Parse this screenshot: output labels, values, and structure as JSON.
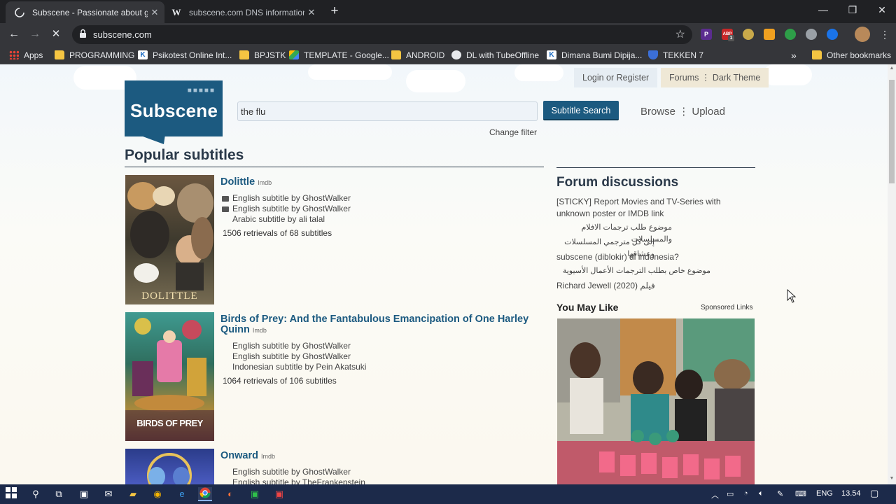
{
  "browser": {
    "tabs": [
      {
        "title": "Subscene - Passionate about goo",
        "active": true,
        "icon": "loading-spinner-icon"
      },
      {
        "title": "subscene.com DNS information -",
        "active": false,
        "icon": "w-icon"
      }
    ],
    "url": "subscene.com",
    "bookmarks": [
      "Apps",
      "PROGRAMMING",
      "Psikotest Online Int...",
      "BPJSTK",
      "TEMPLATE - Google...",
      "ANDROID",
      "DL with TubeOffline",
      "Dimana Bumi Dipija...",
      "TEKKEN 7"
    ],
    "other_bookmarks": "Other bookmarks",
    "more": "»",
    "ext_p": "P",
    "ext_abp": "ABP",
    "ext_badge": "1",
    "tab_w": "W"
  },
  "site": {
    "logo": "Subscene",
    "login": "Login or Register",
    "forums": "Forums",
    "dark_theme": "Dark Theme",
    "search_value": "the flu",
    "search_button": "Subtitle Search",
    "browse": "Browse",
    "upload": "Upload",
    "change_filter": "Change filter",
    "popular_heading": "Popular subtitles"
  },
  "movies": [
    {
      "title": "Dolittle",
      "imdb": "Imdb",
      "subs": [
        "English subtitle by GhostWalker",
        "English subtitle by GhostWalker",
        "Arabic subtitle by ali talal"
      ],
      "retrievals": "1506 retrievals of 68 subtitles",
      "poster_text": "DOLITTLE"
    },
    {
      "title": "Birds of Prey: And the Fantabulous Emancipation of One Harley Quinn",
      "imdb": "Imdb",
      "subs": [
        "English subtitle by GhostWalker",
        "English subtitle by GhostWalker",
        "Indonesian subtitle by Pein Akatsuki"
      ],
      "retrievals": "1064 retrievals of 106 subtitles",
      "poster_text": "BIRDS OF PREY"
    },
    {
      "title": "Onward",
      "imdb": "Imdb",
      "subs": [
        "English subtitle by GhostWalker",
        "English subtitle by TheFrankenstein"
      ]
    }
  ],
  "forum": {
    "heading": "Forum discussions",
    "items": [
      "[STICKY] Report Movies and TV-Series with unknown poster or IMDB link",
      "موضوع طلب ترجمات الافلام والمسلسلات",
      "إلى كل مترجمي المسلسلات وعشاقها",
      "subscene (diblokir) di indonesia?",
      "موضوع خاص بطلب الترجمات الأعمال الأسيوية",
      "Richard Jewell (2020) فيلم"
    ]
  },
  "ad": {
    "heading": "You May Like",
    "sponsored": "Sponsored Links"
  },
  "taskbar": {
    "lang": "ENG",
    "time": "13.54"
  }
}
